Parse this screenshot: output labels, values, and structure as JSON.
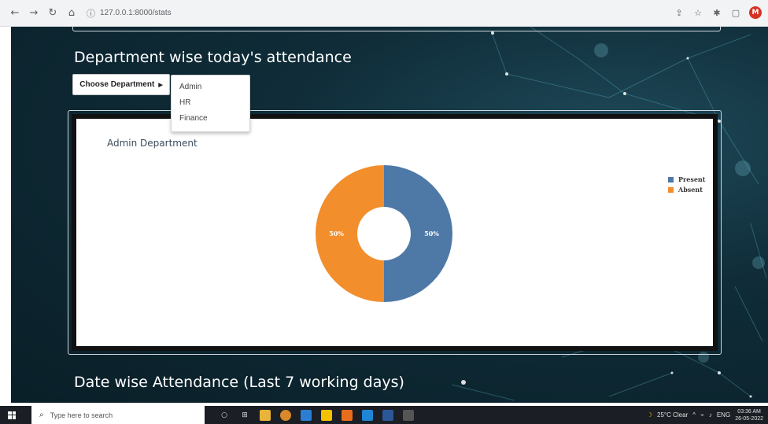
{
  "browser": {
    "url": "127.0.0.1:8000/stats",
    "profile_initial": "M"
  },
  "page": {
    "section1_title": "Department wise today's attendance",
    "dropdown": {
      "label": "Choose Department",
      "options": [
        "Admin",
        "HR",
        "Finance"
      ]
    },
    "section2_title": "Date wise Attendance (Last 7 working days)"
  },
  "chart_data": {
    "type": "pie",
    "title": "Admin Department",
    "style": "donut",
    "legend_position": "right",
    "slices": [
      {
        "label": "Present",
        "value": 50,
        "display": "50%",
        "color": "#4e79a7"
      },
      {
        "label": "Absent",
        "value": 50,
        "display": "50%",
        "color": "#f28e2b"
      }
    ]
  },
  "taskbar": {
    "search_placeholder": "Type here to search",
    "weather": "25°C  Clear",
    "language": "ENG",
    "time": "03:36 AM",
    "date": "26-05-2022"
  }
}
